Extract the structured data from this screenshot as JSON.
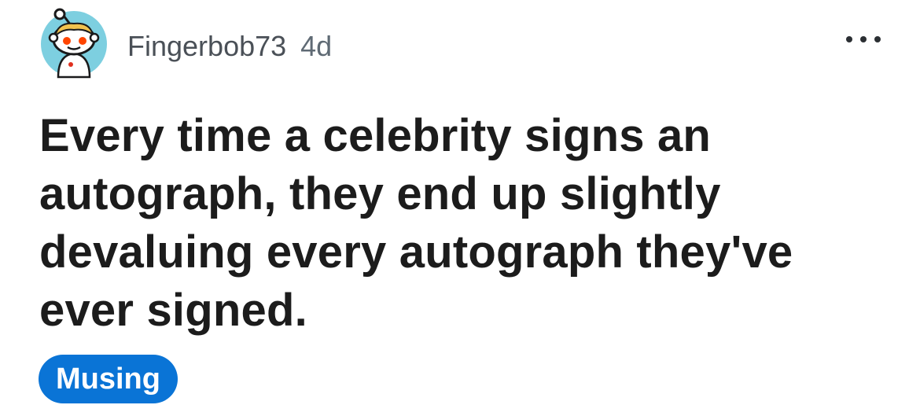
{
  "post": {
    "username": "Fingerbob73",
    "age": "4d",
    "title": "Every time a celebrity signs an autograph, they end up slightly devaluing every autograph they've ever signed.",
    "flair": "Musing"
  },
  "icons": {
    "avatar": "snoo-avatar-icon",
    "more": "more-options-icon"
  },
  "colors": {
    "flair_bg": "#0a74d6",
    "flair_text": "#ffffff",
    "avatar_bg": "#7dcfe0",
    "meta_text": "#4a5057"
  }
}
